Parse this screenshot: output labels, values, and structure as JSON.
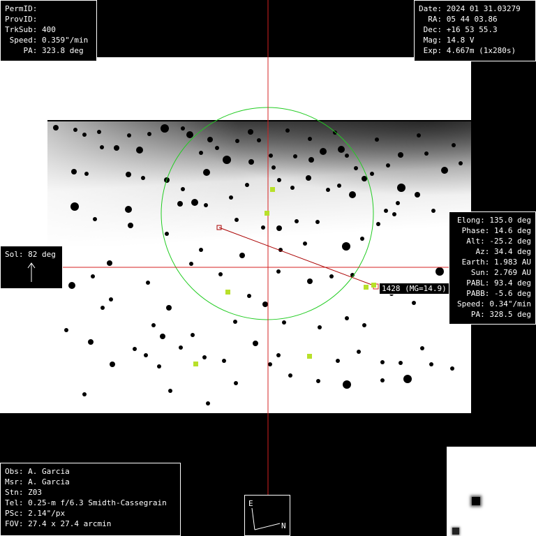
{
  "top_left": {
    "rows": [
      "PermID:",
      "ProvID:",
      "TrkSub: 400",
      " Speed: 0.359\"/min",
      "    PA: 323.8 deg"
    ]
  },
  "top_right": {
    "rows": [
      "Date: 2024 01 31.03279",
      "  RA: 05 44 03.86",
      " Dec: +16 53 55.3",
      " Mag: 14.8 V",
      " Exp: 4.667m (1x280s)"
    ]
  },
  "right_panel": {
    "rows": [
      "Elong: 135.0 deg",
      "Phase: 14.6 deg",
      "Alt: -25.2 deg",
      "Az: 34.4 deg",
      "Earth: 1.983 AU",
      "Sun: 2.769 AU",
      "PABL: 93.4 deg",
      "PABB: -5.6 deg",
      "Speed: 0.34\"/min",
      "PA: 328.5 deg"
    ]
  },
  "bottom_left": {
    "rows": [
      "Obs: A. Garcia",
      "Msr: A. Garcia",
      "Stn: Z03",
      "Tel: 0.25-m f/6.3 Smidth-Cassegrain",
      "PSc: 2.14\"/px",
      "FOV: 27.4 x 27.4 arcmin"
    ]
  },
  "sol": {
    "label": "Sol: 82 deg"
  },
  "compass": {
    "east": "E",
    "north": "N"
  },
  "target": {
    "label": "1428 (MG=14.9)"
  },
  "colors": {
    "crosshair": "#d42020",
    "circle": "#22cc22",
    "marker": "#b8e02a",
    "track": "#aa0000",
    "panel_border": "#ffffff"
  }
}
